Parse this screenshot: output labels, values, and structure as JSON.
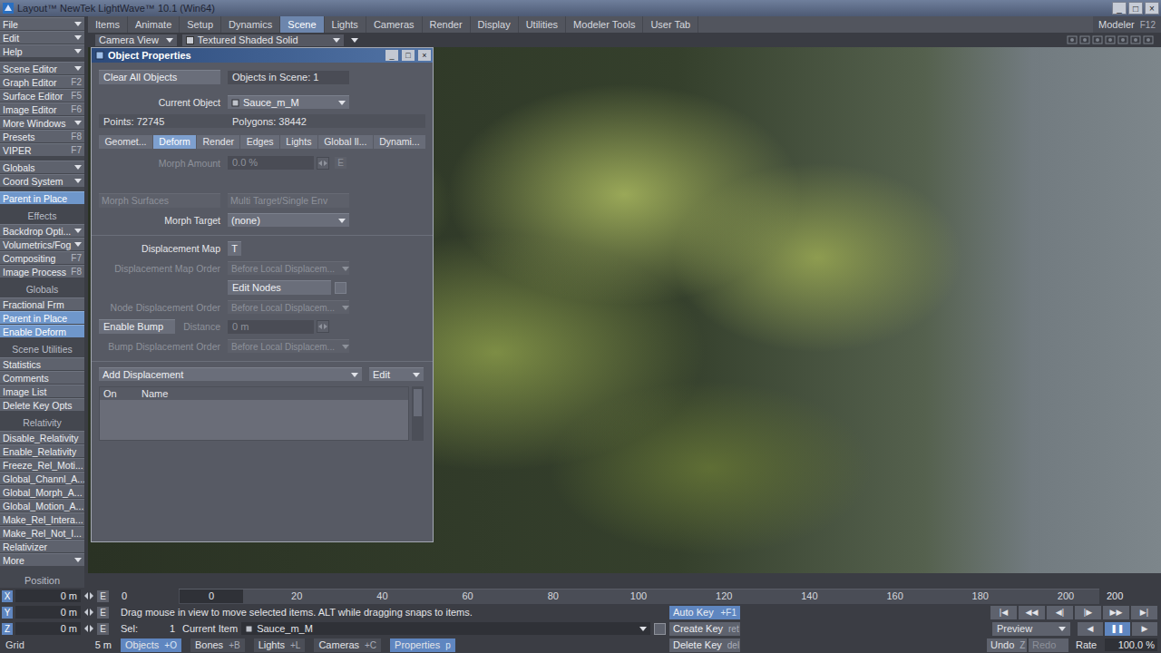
{
  "window": {
    "title": "Layout™ NewTek LightWave™ 10.1 (Win64)",
    "controls": [
      "_",
      "□",
      "×"
    ]
  },
  "toolbar": {
    "tabs": [
      {
        "label": "Items",
        "selected": false
      },
      {
        "label": "Animate",
        "selected": false
      },
      {
        "label": "Setup",
        "selected": false
      },
      {
        "label": "Dynamics",
        "selected": false
      },
      {
        "label": "Scene",
        "selected": true
      },
      {
        "label": "Lights",
        "selected": false
      },
      {
        "label": "Cameras",
        "selected": false
      },
      {
        "label": "Render",
        "selected": false
      },
      {
        "label": "Display",
        "selected": false
      },
      {
        "label": "Utilities",
        "selected": false
      },
      {
        "label": "Modeler Tools",
        "selected": false
      },
      {
        "label": "User Tab",
        "selected": false
      }
    ],
    "modeler": {
      "label": "Modeler",
      "shortcut": "F12"
    }
  },
  "sidebar": {
    "groups": [
      {
        "header": "",
        "items": [
          {
            "label": "File",
            "kind": "dropdown",
            "shortcut": "",
            "selected": false
          },
          {
            "label": "Edit",
            "kind": "dropdown",
            "shortcut": "",
            "selected": false
          },
          {
            "label": "Help",
            "kind": "dropdown",
            "shortcut": "",
            "selected": false
          }
        ]
      },
      {
        "header": "",
        "items": [
          {
            "label": "Scene Editor",
            "kind": "dropdown",
            "shortcut": "",
            "selected": false
          },
          {
            "label": "Graph Editor",
            "kind": "button",
            "shortcut": "F2",
            "selected": false
          },
          {
            "label": "Surface Editor",
            "kind": "button",
            "shortcut": "F5",
            "selected": false
          },
          {
            "label": "Image Editor",
            "kind": "button",
            "shortcut": "F6",
            "selected": false
          },
          {
            "label": "More Windows",
            "kind": "dropdown",
            "shortcut": "",
            "selected": false
          },
          {
            "label": "Presets",
            "kind": "button",
            "shortcut": "F8",
            "selected": false
          },
          {
            "label": "VIPER",
            "kind": "button",
            "shortcut": "F7",
            "selected": false
          }
        ]
      },
      {
        "header": "",
        "items": [
          {
            "label": "Globals",
            "kind": "dropdown",
            "shortcut": "",
            "selected": false
          },
          {
            "label": "Coord System",
            "kind": "dropdown",
            "shortcut": "",
            "selected": false
          }
        ]
      },
      {
        "header": "",
        "items": [
          {
            "label": "Parent in Place",
            "kind": "button",
            "shortcut": "",
            "selected": true
          }
        ]
      },
      {
        "header": "Effects",
        "items": [
          {
            "label": "Backdrop Opti...",
            "kind": "dropdown",
            "shortcut": "",
            "selected": false
          },
          {
            "label": "Volumetrics/Fog",
            "kind": "dropdown",
            "shortcut": "",
            "selected": false
          },
          {
            "label": "Compositing",
            "kind": "button",
            "shortcut": "F7",
            "selected": false
          },
          {
            "label": "Image Process",
            "kind": "button",
            "shortcut": "F8",
            "selected": false
          }
        ]
      },
      {
        "header": "Globals",
        "items": [
          {
            "label": "Fractional Frm",
            "kind": "button",
            "shortcut": "",
            "selected": false
          },
          {
            "label": "Parent in Place",
            "kind": "button",
            "shortcut": "",
            "selected": true
          },
          {
            "label": "Enable Deform",
            "kind": "button",
            "shortcut": "",
            "selected": true
          }
        ]
      },
      {
        "header": "Scene Utilities",
        "items": [
          {
            "label": "Statistics",
            "kind": "button",
            "shortcut": "",
            "selected": false
          },
          {
            "label": "Comments",
            "kind": "button",
            "shortcut": "",
            "selected": false
          },
          {
            "label": "Image List",
            "kind": "button",
            "shortcut": "",
            "selected": false
          },
          {
            "label": "Delete Key Opts",
            "kind": "button",
            "shortcut": "",
            "selected": false
          }
        ]
      },
      {
        "header": "Relativity",
        "items": [
          {
            "label": "Disable_Relativity",
            "kind": "button",
            "shortcut": "",
            "selected": false
          },
          {
            "label": "Enable_Relativity",
            "kind": "button",
            "shortcut": "",
            "selected": false
          },
          {
            "label": "Freeze_Rel_Moti...",
            "kind": "button",
            "shortcut": "",
            "selected": false
          },
          {
            "label": "Global_Channl_A...",
            "kind": "button",
            "shortcut": "",
            "selected": false
          },
          {
            "label": "Global_Morph_A...",
            "kind": "button",
            "shortcut": "",
            "selected": false
          },
          {
            "label": "Global_Motion_A...",
            "kind": "button",
            "shortcut": "",
            "selected": false
          },
          {
            "label": "Make_Rel_Intera...",
            "kind": "button",
            "shortcut": "",
            "selected": false
          },
          {
            "label": "Make_Rel_Not_I...",
            "kind": "button",
            "shortcut": "",
            "selected": false
          },
          {
            "label": "Relativizer",
            "kind": "button",
            "shortcut": "",
            "selected": false
          },
          {
            "label": "More",
            "kind": "dropdown",
            "shortcut": "",
            "selected": false
          }
        ]
      }
    ]
  },
  "view": {
    "camera": "Camera View",
    "shading": "Textured Shaded Solid"
  },
  "object_properties": {
    "title": "Object Properties",
    "controls": [
      "_",
      "□",
      "×"
    ],
    "clear_button": "Clear All Objects",
    "objects_in_scene": "Objects in Scene: 1",
    "current_object": {
      "label": "Current Object",
      "value": "Sauce_m_M"
    },
    "points": "Points: 72745",
    "polygons": "Polygons: 38442",
    "tabs": [
      {
        "label": "Geomet...",
        "selected": false
      },
      {
        "label": "Deform",
        "selected": true
      },
      {
        "label": "Render",
        "selected": false
      },
      {
        "label": "Edges",
        "selected": false
      },
      {
        "label": "Lights",
        "selected": false
      },
      {
        "label": "Global Il...",
        "selected": false
      },
      {
        "label": "Dynami...",
        "selected": false
      }
    ],
    "morph_amount": {
      "label": "Morph Amount",
      "value": "0.0 %",
      "envelope": "E",
      "disabled": true
    },
    "morph_buttons": [
      {
        "label": "Morph Surfaces",
        "disabled": true
      },
      {
        "label": "Multi Target/Single Env",
        "disabled": true
      }
    ],
    "morph_target": {
      "label": "Morph Target",
      "value": "(none)",
      "disabled": false
    },
    "displacement_map": {
      "label": "Displacement Map",
      "button": "T"
    },
    "displacement_map_order": {
      "label": "Displacement Map Order",
      "value": "Before Local Displacem...",
      "disabled": true
    },
    "edit_nodes": {
      "label": "Edit Nodes"
    },
    "node_displacement_order": {
      "label": "Node Displacement Order",
      "value": "Before Local Displacem...",
      "disabled": true
    },
    "bump": {
      "button": "Enable Bump",
      "label": "Distance",
      "value": "0 m",
      "disabled": true
    },
    "bump_displacement_order": {
      "label": "Bump Displacement Order",
      "value": "Before Local Displacem...",
      "disabled": true
    },
    "add_displacement": {
      "label": "Add Displacement",
      "edit": "Edit"
    },
    "displacement_list": {
      "columns": [
        "On",
        "Name"
      ],
      "rows": []
    }
  },
  "position": {
    "label": "Position",
    "axes": [
      {
        "axis": "X",
        "value": "0 m"
      },
      {
        "axis": "Y",
        "value": "0 m"
      },
      {
        "axis": "Z",
        "value": "0 m"
      }
    ],
    "envelope": "E"
  },
  "grid": {
    "label": "Grid",
    "value": "5 m"
  },
  "timeline": {
    "start": "0",
    "end": "200",
    "current": "0",
    "level": 0,
    "ticks": [
      "20",
      "40",
      "60",
      "80",
      "100",
      "120",
      "140",
      "160",
      "180",
      "200"
    ]
  },
  "status": "Drag mouse in view to move selected items. ALT while dragging snaps to items.",
  "selection": {
    "label": "Sel:",
    "count": "1",
    "current_item_label": "Current Item",
    "current_item": "Sauce_m_M"
  },
  "item_types": [
    {
      "label": "Objects",
      "shortcut": "+O",
      "selected": true
    },
    {
      "label": "Bones",
      "shortcut": "+B",
      "selected": false
    },
    {
      "label": "Lights",
      "shortcut": "+L",
      "selected": false
    },
    {
      "label": "Cameras",
      "shortcut": "+C",
      "selected": false
    },
    {
      "label": "Properties",
      "shortcut": "p",
      "selected": true
    }
  ],
  "keys": [
    {
      "label": "Auto Key",
      "shortcut": "+F1",
      "selected": true
    },
    {
      "label": "Create Key",
      "shortcut": "ret",
      "selected": false
    },
    {
      "label": "Delete Key",
      "shortcut": "del",
      "selected": false
    }
  ],
  "transport": {
    "buttons": [
      {
        "label": "|◀",
        "selected": false
      },
      {
        "label": "◀◀",
        "selected": false
      },
      {
        "label": "◀|",
        "selected": false
      },
      {
        "label": "|▶",
        "selected": false
      },
      {
        "label": "▶▶",
        "selected": false
      },
      {
        "label": "▶|",
        "selected": false
      }
    ],
    "preview": "Preview",
    "play": [
      {
        "label": "◀",
        "selected": false
      },
      {
        "label": "❚❚",
        "selected": true
      },
      {
        "label": "▶",
        "selected": false
      }
    ]
  },
  "history": {
    "undo": {
      "label": "Undo",
      "shortcut": "Z",
      "disabled": false
    },
    "redo": {
      "label": "Redo",
      "disabled": true
    }
  },
  "rate": {
    "label": "Rate",
    "value": "100.0 %"
  }
}
